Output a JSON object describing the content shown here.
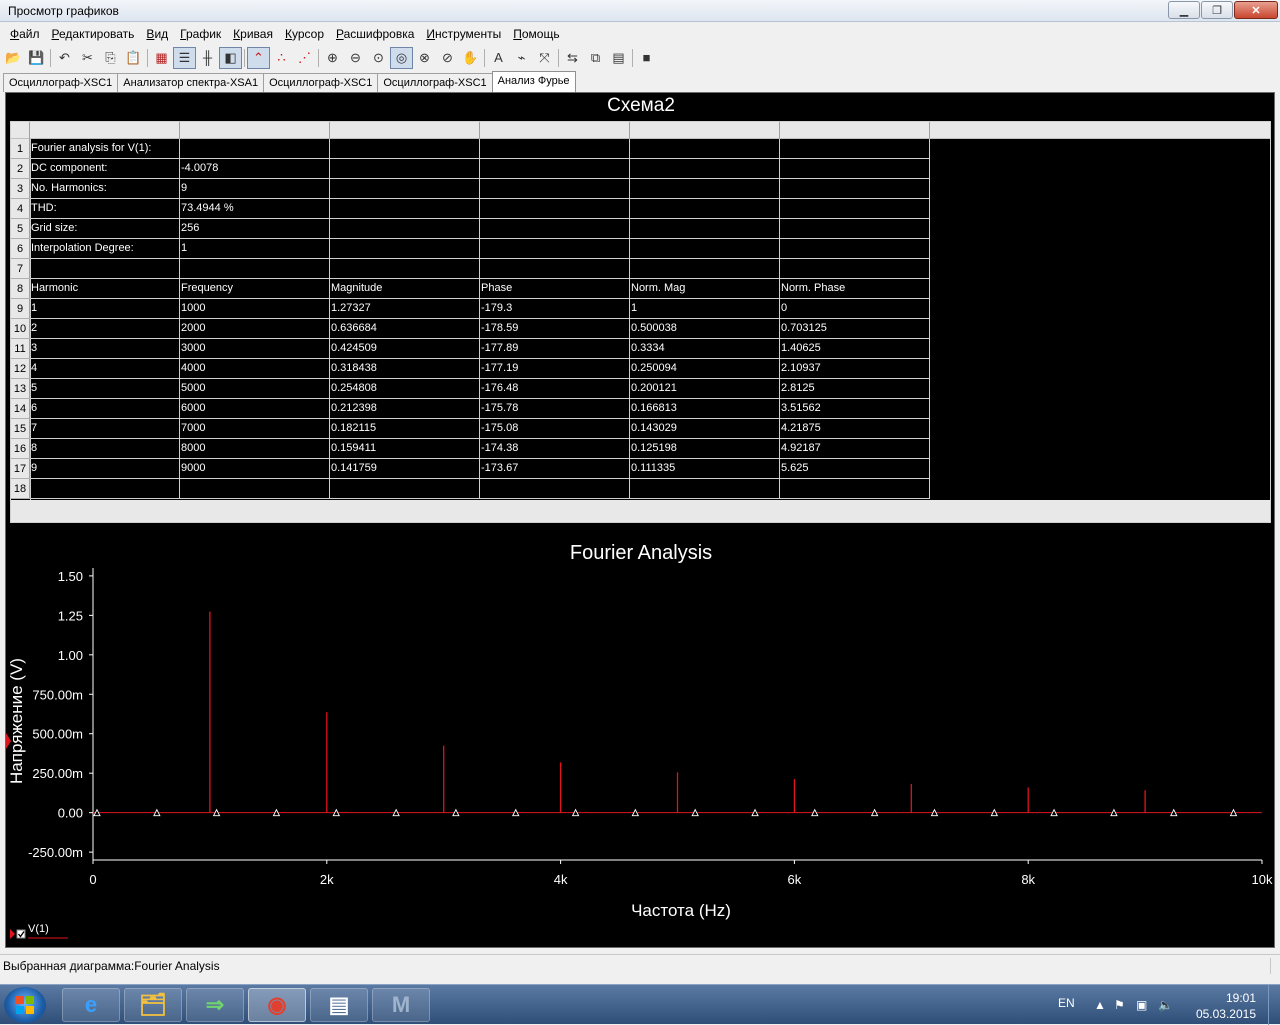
{
  "window": {
    "title": "Просмотр графиков",
    "minimize_glyph": "▁",
    "maximize_glyph": "❐",
    "close_glyph": "✕"
  },
  "menu": [
    "Файл",
    "Редактировать",
    "Вид",
    "График",
    "Кривая",
    "Курсор",
    "Расшифровка",
    "Инструменты",
    "Помощь"
  ],
  "toolbar_icons": [
    "open-icon",
    "save-icon",
    "undo-icon",
    "cut-icon",
    "copy-icon",
    "paste-icon",
    "grid-icon",
    "legend-icon",
    "ticks-icon",
    "background-icon",
    "lines-icon",
    "dots-icon",
    "lines-dots-icon",
    "zoom-in-icon",
    "zoom-out-icon",
    "zoom-area-icon",
    "zoom-full-icon",
    "zoom-x-icon",
    "zoom-y-icon",
    "pan-icon",
    "text-icon",
    "cursor-icon",
    "reverse-colors-icon",
    "export-icon",
    "overlay-icon",
    "properties-icon",
    "stop-icon"
  ],
  "tabs": [
    {
      "label": "Осциллограф-XSC1",
      "active": false
    },
    {
      "label": "Анализатор спектра-XSA1",
      "active": false
    },
    {
      "label": "Осциллограф-XSC1",
      "active": false
    },
    {
      "label": "Осциллограф-XSC1",
      "active": false
    },
    {
      "label": "Анализ Фурье",
      "active": true
    }
  ],
  "schema_title": "Схема2",
  "table": {
    "rows": [
      [
        "Fourier analysis for V(1):",
        "",
        "",
        "",
        "",
        ""
      ],
      [
        "DC component:",
        "-4.0078",
        "",
        "",
        "",
        ""
      ],
      [
        "No. Harmonics:",
        "9",
        "",
        "",
        "",
        ""
      ],
      [
        "THD:",
        "73.4944 %",
        "",
        "",
        "",
        ""
      ],
      [
        "Grid size:",
        "256",
        "",
        "",
        "",
        ""
      ],
      [
        "Interpolation Degree:",
        "1",
        "",
        "",
        "",
        ""
      ],
      [
        "",
        "",
        "",
        "",
        "",
        ""
      ],
      [
        "Harmonic",
        "Frequency",
        "Magnitude",
        "Phase",
        "Norm. Mag",
        "Norm. Phase"
      ],
      [
        "1",
        "1000",
        "1.27327",
        "-179.3",
        "1",
        "0"
      ],
      [
        "2",
        "2000",
        "0.636684",
        "-178.59",
        "0.500038",
        "0.703125"
      ],
      [
        "3",
        "3000",
        "0.424509",
        "-177.89",
        "0.3334",
        "1.40625"
      ],
      [
        "4",
        "4000",
        "0.318438",
        "-177.19",
        "0.250094",
        "2.10937"
      ],
      [
        "5",
        "5000",
        "0.254808",
        "-176.48",
        "0.200121",
        "2.8125"
      ],
      [
        "6",
        "6000",
        "0.212398",
        "-175.78",
        "0.166813",
        "3.51562"
      ],
      [
        "7",
        "7000",
        "0.182115",
        "-175.08",
        "0.143029",
        "4.21875"
      ],
      [
        "8",
        "8000",
        "0.159411",
        "-174.38",
        "0.125198",
        "4.92187"
      ],
      [
        "9",
        "9000",
        "0.141759",
        "-173.67",
        "0.111335",
        "5.625"
      ],
      [
        "",
        "",
        "",
        "",
        "",
        ""
      ]
    ],
    "row_numbers": [
      "1",
      "2",
      "3",
      "4",
      "5",
      "6",
      "7",
      "8",
      "9",
      "10",
      "11",
      "12",
      "13",
      "14",
      "15",
      "16",
      "17",
      "18"
    ]
  },
  "chart_data": {
    "type": "bar",
    "title": "Fourier Analysis",
    "xlabel": "Частота (Hz)",
    "ylabel": "Напряжение (V)",
    "xlim": [
      0,
      10000
    ],
    "ylim": [
      -0.3,
      1.55
    ],
    "x_ticks": [
      0,
      2000,
      4000,
      6000,
      8000,
      10000
    ],
    "x_tick_labels": [
      "0",
      "2k",
      "4k",
      "6k",
      "8k",
      "10k"
    ],
    "y_ticks": [
      -0.25,
      0,
      0.25,
      0.5,
      0.75,
      1.0,
      1.25,
      1.5
    ],
    "y_tick_labels": [
      "-250.00m",
      "0.00",
      "250.00m",
      "500.00m",
      "750.00m",
      "1.00",
      "1.25",
      "1.50"
    ],
    "grid": false,
    "legend": "bottom-left",
    "series": [
      {
        "name": "V(1)",
        "color": "#e0141e",
        "x": [
          1000,
          2000,
          3000,
          4000,
          5000,
          6000,
          7000,
          8000,
          9000
        ],
        "values": [
          1.27327,
          0.636684,
          0.424509,
          0.318438,
          0.254808,
          0.212398,
          0.182115,
          0.159411,
          0.141759
        ]
      }
    ],
    "marker_x": [
      0,
      512,
      1023,
      1535,
      2047,
      2559,
      3070,
      3582,
      4094,
      4605,
      5117,
      5629,
      6140,
      6652,
      7164,
      7676,
      8187,
      8699,
      9211,
      9722
    ],
    "background": "#000000",
    "axis_color": "#ffffff"
  },
  "status": {
    "text": "Выбранная диаграмма:Fourier Analysis"
  },
  "taskbar": {
    "apps": [
      "ie-icon",
      "explorer-icon",
      "network-app-icon",
      "chrome-icon",
      "multisim-icon",
      "mathcad-icon"
    ],
    "language": "EN",
    "time": "19:01",
    "date": "05.03.2015"
  }
}
